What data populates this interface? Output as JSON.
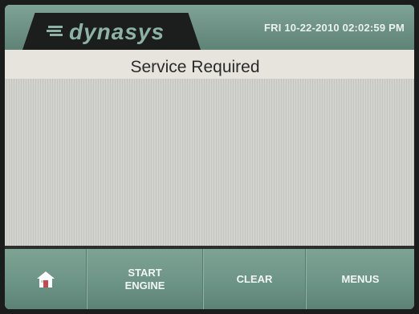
{
  "header": {
    "logo_text": "dynasys",
    "datetime": "FRI 10-22-2010 02:02:59 PM"
  },
  "title": "Service Required",
  "footer": {
    "home_icon": "home-icon",
    "start_line1": "START",
    "start_line2": "ENGINE",
    "clear_label": "CLEAR",
    "menus_label": "MENUS"
  },
  "colors": {
    "header_bg": "#6b9083",
    "footer_bg": "#6b9385",
    "content_bg": "#cfd1cd"
  }
}
